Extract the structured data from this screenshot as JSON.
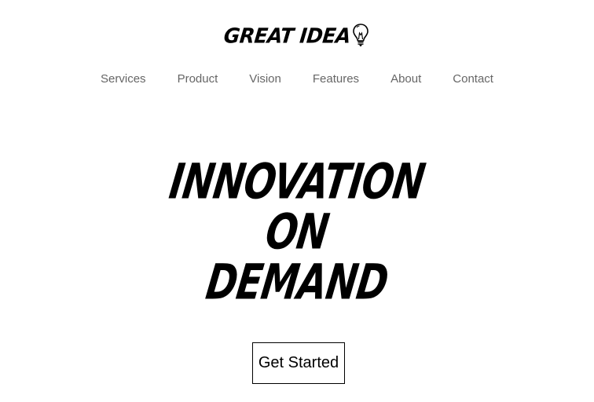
{
  "brand": {
    "name": "GREAT IDEA",
    "icon": "lightbulb-icon"
  },
  "nav": {
    "items": [
      {
        "label": "Services"
      },
      {
        "label": "Product"
      },
      {
        "label": "Vision"
      },
      {
        "label": "Features"
      },
      {
        "label": "About"
      },
      {
        "label": "Contact"
      }
    ]
  },
  "hero": {
    "lines": [
      "INNOVATION",
      "ON",
      "DEMAND"
    ],
    "cta_label": "Get Started"
  },
  "colors": {
    "text": "#000000",
    "nav_text": "#666666",
    "background": "#ffffff"
  }
}
